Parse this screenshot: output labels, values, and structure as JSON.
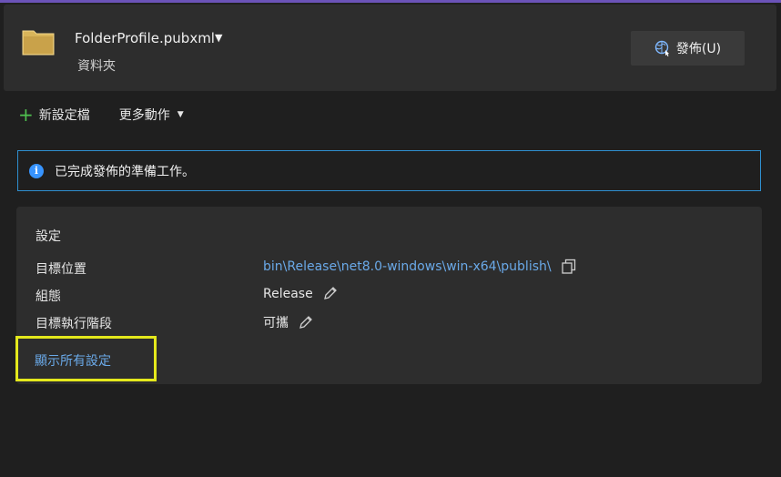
{
  "header": {
    "profile_name": "FolderProfile.pubxml",
    "profile_type": "資料夾",
    "publish_button": "發佈(U)"
  },
  "toolbar": {
    "new_profile": "新設定檔",
    "more_actions": "更多動作"
  },
  "info": {
    "message": "已完成發佈的準備工作。"
  },
  "settings": {
    "title": "設定",
    "target_location_label": "目標位置",
    "target_location_value": "bin\\Release\\net8.0-windows\\win-x64\\publish\\",
    "configuration_label": "組態",
    "configuration_value": "Release",
    "target_runtime_label": "目標執行階段",
    "target_runtime_value": "可攜",
    "show_all_link": "顯示所有設定"
  },
  "colors": {
    "accent_link": "#6aa9e8",
    "info_border": "#2f8fcf",
    "highlight": "#e4e81c",
    "top_line": "#6b53b8"
  }
}
